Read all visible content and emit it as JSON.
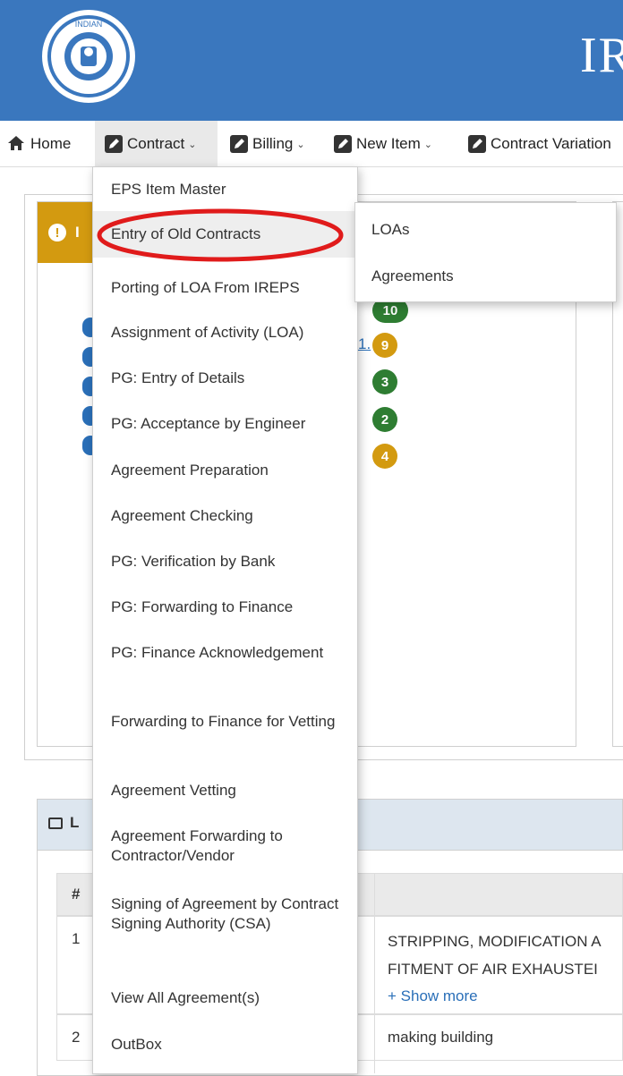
{
  "header": {
    "title": "IR"
  },
  "nav": {
    "home": "Home",
    "contract": "Contract",
    "billing": "Billing",
    "new_item": "New Item",
    "contract_variation": "Contract Variation"
  },
  "contract_menu": {
    "items": [
      "EPS Item Master",
      "Entry of Old Contracts",
      "Porting of LOA From IREPS",
      "Assignment of Activity (LOA)",
      "PG: Entry of Details",
      "PG: Acceptance by Engineer",
      "Agreement Preparation",
      "Agreement Checking",
      "PG: Verification by Bank",
      "PG: Forwarding to Finance",
      "PG: Finance Acknowledgement",
      "Forwarding to Finance for Vetting",
      "Agreement Vetting",
      "Agreement Forwarding to Contractor/Vendor",
      "Signing of Agreement by Contract Signing Authority (CSA)",
      "View All Agreement(s)",
      "OutBox"
    ]
  },
  "submenu": {
    "items": [
      "LOAs",
      "Agreements"
    ]
  },
  "dashboard": {
    "badges": [
      "10",
      "9",
      "3",
      "2",
      "4"
    ],
    "partial_link": "1.",
    "table": {
      "header_num": "#",
      "rows": [
        {
          "num": "1",
          "desc_line1": "STRIPPING, MODIFICATION A",
          "desc_line2": "FITMENT OF AIR EXHAUSTEI",
          "show_more": "+ Show more"
        },
        {
          "num": "2",
          "desc_line1": "making building"
        }
      ]
    },
    "section_label_partial": "L",
    "alert_label_partial": "I"
  },
  "colors": {
    "header_bg": "#3a77be",
    "alert_gold": "#d39a10",
    "badge_green": "#2e7d32",
    "annotation_red": "#e01b1b",
    "purple_strip": "#6a3d8f"
  }
}
